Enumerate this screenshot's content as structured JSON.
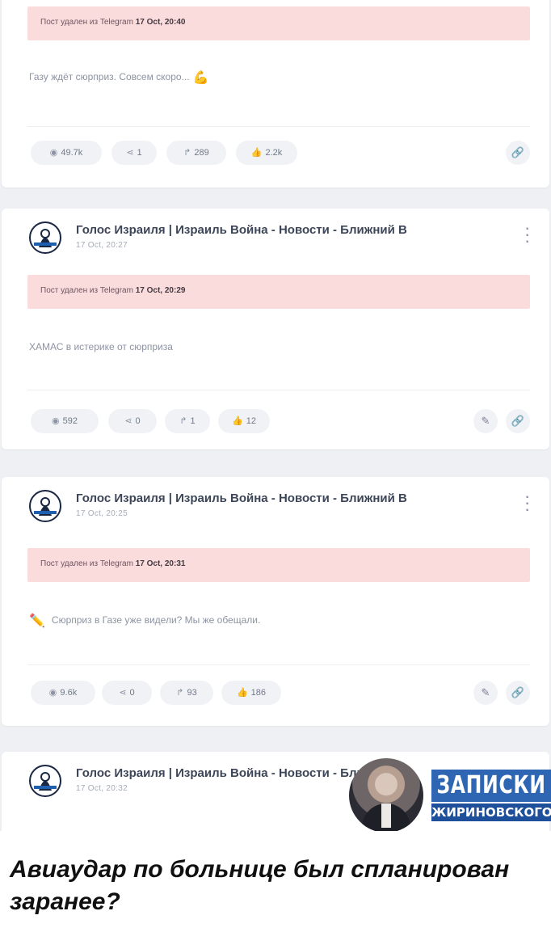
{
  "channel": {
    "title": "Голос Израиля | Израиль Война - Новости - Ближний В",
    "avatar_icon": "channel-logo-icon"
  },
  "posts": [
    {
      "deleted_prefix": "Пост удален из Telegram",
      "deleted_time": "17 Oct, 20:40",
      "text": "Газу ждёт сюрприз. Совсем скоро...",
      "text_icon": "flexed-biceps-emoji",
      "stats": {
        "views": "49.7k",
        "shares": "1",
        "forwards": "289",
        "likes": "2.2k"
      },
      "actions": [
        "link-icon"
      ]
    },
    {
      "date": "17 Oct, 20:27",
      "deleted_prefix": "Пост удален из Telegram",
      "deleted_time": "17 Oct, 20:29",
      "text": "ХАМАС в истерике от сюрприза",
      "stats": {
        "views": "592",
        "shares": "0",
        "forwards": "1",
        "likes": "12"
      },
      "actions": [
        "edit-icon",
        "link-icon"
      ]
    },
    {
      "date": "17 Oct, 20:25",
      "deleted_prefix": "Пост удален из Telegram",
      "deleted_time": "17 Oct, 20:31",
      "text": "Сюрприз в Газе уже видели? Мы же обещали.",
      "text_icon": "pencil-emoji",
      "stats": {
        "views": "9.6k",
        "shares": "0",
        "forwards": "93",
        "likes": "186"
      },
      "actions": [
        "edit-icon",
        "link-icon"
      ]
    },
    {
      "date": "17 Oct, 20:32"
    }
  ],
  "watermark": {
    "line1": "ЗАПИСКИ",
    "line2": "ЖИРИНОВСКОГО"
  },
  "caption": "Авиаудар по больнице был спланирован заранее?"
}
